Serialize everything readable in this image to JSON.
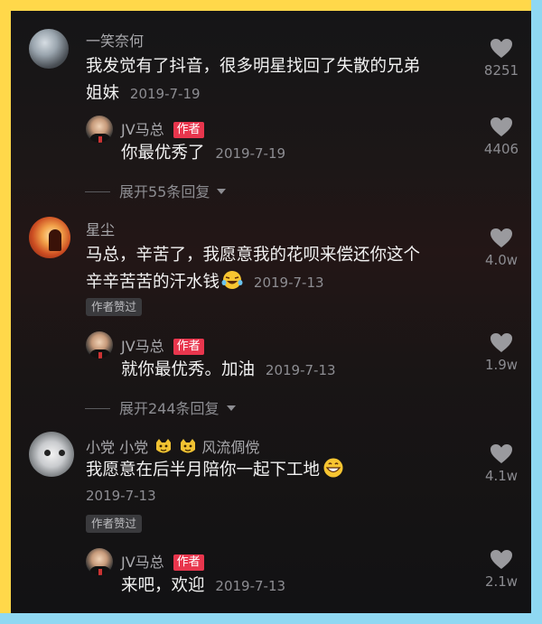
{
  "comments": [
    {
      "username": "一笑奈何",
      "text_line1": "我发觉有了抖音，很多明星找回了失散的兄弟",
      "text_line2": "姐妹",
      "date": "2019-7-19",
      "like_count": "8251",
      "reply": {
        "username": "JV马总",
        "tag": "作者",
        "text": "你最优秀了",
        "date": "2019-7-19",
        "like_count": "4406"
      },
      "expand_label": "展开55条回复"
    },
    {
      "username": "星尘",
      "text_line1": "马总，辛苦了，我愿意我的花呗来偿还你这个",
      "text_line2": "辛辛苦苦的汗水钱",
      "date": "2019-7-13",
      "like_count": "4.0w",
      "liked_badge": "作者赞过",
      "reply": {
        "username": "JV马总",
        "tag": "作者",
        "text": "就你最优秀。加油",
        "date": "2019-7-13",
        "like_count": "1.9w"
      },
      "expand_label": "展开244条回复"
    },
    {
      "username_part1": "小党 小党",
      "username_part2": "风流倜傥",
      "text_line1": "我愿意在后半月陪你一起下工地",
      "date": "2019-7-13",
      "like_count": "4.1w",
      "liked_badge": "作者赞过",
      "reply": {
        "username": "JV马总",
        "tag": "作者",
        "text": "来吧，欢迎",
        "date": "2019-7-13",
        "like_count": "2.1w"
      }
    }
  ],
  "icons": {
    "like": "heart-icon",
    "expand": "chevron-down-icon",
    "emoji_1": "laughing-tears-emoji",
    "emoji_2": "cat-emoji",
    "emoji_3": "grinning-emoji"
  },
  "colors": {
    "background": "#161516",
    "author_tag": "#e8364d",
    "frame_top": "#ffd84a",
    "frame_bottom": "#8fd8f2"
  }
}
